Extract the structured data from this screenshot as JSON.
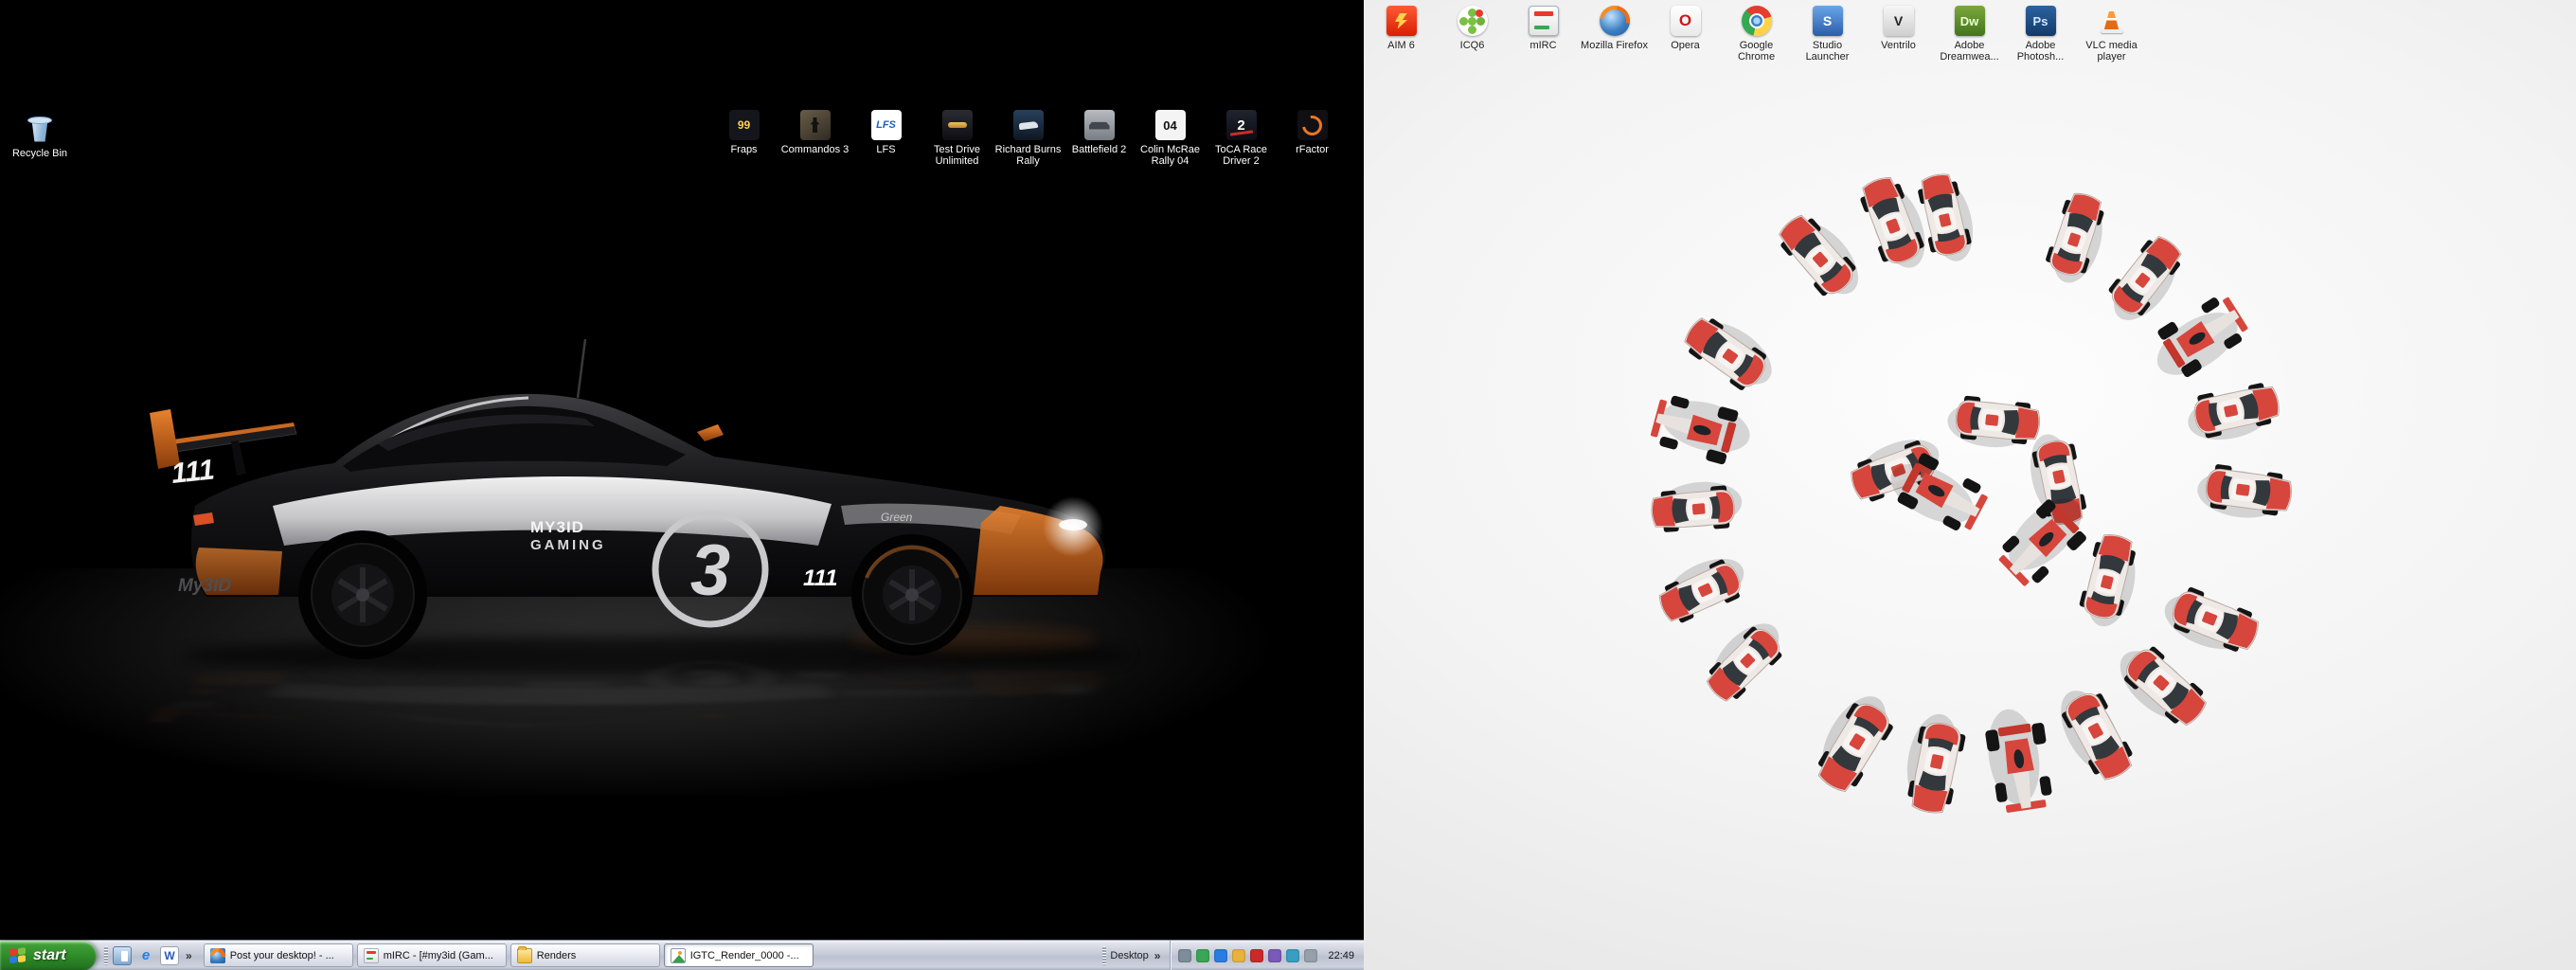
{
  "left_monitor": {
    "recycle_bin": {
      "label": "Recycle Bin",
      "icon": "recycle-bin-icon"
    },
    "icons": [
      {
        "label": "Fraps",
        "icon": "fraps-icon",
        "glyph": "99"
      },
      {
        "label": "Commandos 3",
        "icon": "commandos-3-icon"
      },
      {
        "label": "LFS",
        "icon": "lfs-icon",
        "glyph": "LFS"
      },
      {
        "label": "Test Drive Unlimited",
        "icon": "test-drive-unlimited-icon"
      },
      {
        "label": "Richard Burns Rally",
        "icon": "richard-burns-rally-icon"
      },
      {
        "label": "Battlefield 2",
        "icon": "battlefield-2-icon"
      },
      {
        "label": "Colin McRae Rally 04",
        "icon": "colin-mcrae-rally-04-icon",
        "glyph": "04"
      },
      {
        "label": "ToCA Race Driver 2",
        "icon": "toca-race-driver-2-icon",
        "glyph": "2"
      },
      {
        "label": "rFactor",
        "icon": "rfactor-icon"
      }
    ],
    "wallpaper": {
      "car_number_rear": "111",
      "car_number_door": "111",
      "door_brand_line1": "MY3ID",
      "door_brand_line2": "GAMING",
      "logo_digit": "3",
      "rear_text": "My3ID",
      "sponsor_text": "Green"
    }
  },
  "right_monitor": {
    "icons": [
      {
        "label": "AIM 6",
        "icon": "aim-6-icon"
      },
      {
        "label": "ICQ6",
        "icon": "icq-6-icon"
      },
      {
        "label": "mIRC",
        "icon": "mirc-icon"
      },
      {
        "label": "Mozilla Firefox",
        "icon": "firefox-icon"
      },
      {
        "label": "Opera",
        "icon": "opera-icon",
        "glyph": "O"
      },
      {
        "label": "Google Chrome",
        "icon": "chrome-icon"
      },
      {
        "label": "Studio Launcher",
        "icon": "studio-launcher-icon",
        "glyph": "S"
      },
      {
        "label": "Ventrilo",
        "icon": "ventrilo-icon",
        "glyph": "V"
      },
      {
        "label": "Adobe Dreamwea...",
        "icon": "dreamweaver-icon",
        "glyph": "Dw"
      },
      {
        "label": "Adobe Photosh...",
        "icon": "photoshop-icon",
        "glyph": "Ps"
      },
      {
        "label": "VLC media player",
        "icon": "vlc-icon"
      }
    ]
  },
  "taskbar": {
    "start": {
      "label": "start"
    },
    "quick_launch": [
      {
        "icon": "show-desktop-icon"
      },
      {
        "icon": "internet-explorer-icon",
        "glyph": "e"
      },
      {
        "icon": "word-icon",
        "glyph": "W"
      }
    ],
    "quick_launch_chevron": "»",
    "tasks": [
      {
        "label": "Post your desktop! - ...",
        "icon": "browser-icon",
        "active": false
      },
      {
        "label": "mIRC - [#my3id (Gam...",
        "icon": "mirc-icon",
        "active": false
      },
      {
        "label": "Renders",
        "icon": "folder-icon",
        "active": false
      },
      {
        "label": "IGTC_Render_0000 -...",
        "icon": "image-viewer-icon",
        "active": true
      }
    ],
    "toolbar": {
      "label": "Desktop",
      "chevron": "»"
    },
    "tray_icons": [
      "tray-display-icon",
      "tray-antivirus-icon",
      "tray-network-icon",
      "tray-volume-icon",
      "tray-messenger-icon",
      "tray-graphics-icon",
      "tray-update-icon",
      "tray-remove-hardware-icon"
    ],
    "clock": "22:49"
  }
}
